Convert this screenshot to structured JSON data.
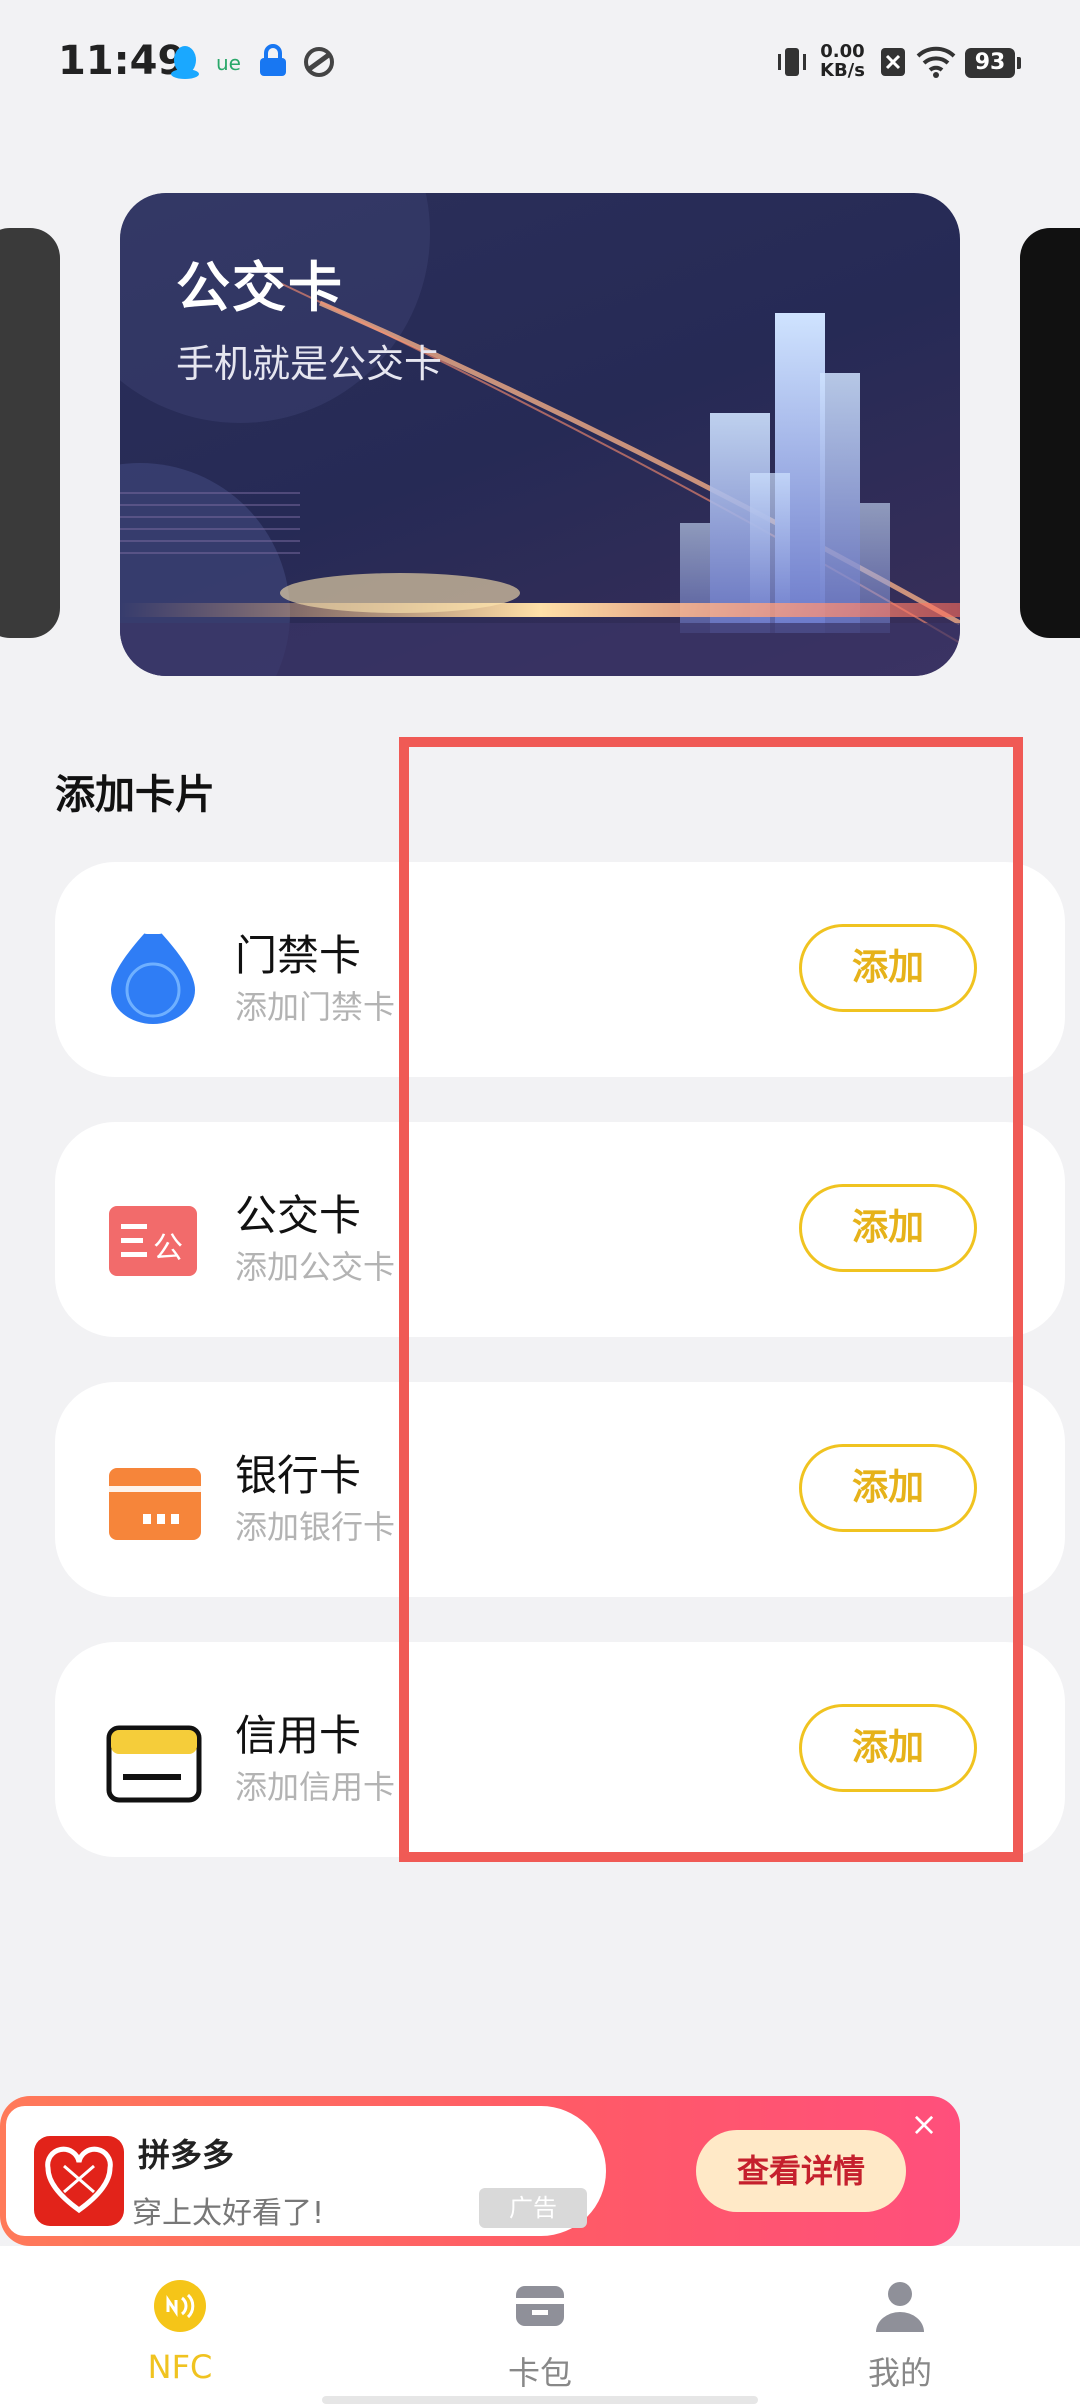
{
  "status_bar": {
    "time": "11:49",
    "net_speed_value": "0.00",
    "net_speed_unit": "KB/s",
    "battery": "93"
  },
  "banner": {
    "title": "公交卡",
    "subtitle": "手机就是公交卡"
  },
  "section": {
    "title": "添加卡片"
  },
  "cards": [
    {
      "name": "门禁卡",
      "desc": "添加门禁卡",
      "button": "添加",
      "icon": "access-card-icon"
    },
    {
      "name": "公交卡",
      "desc": "添加公交卡",
      "button": "添加",
      "icon": "bus-card-icon"
    },
    {
      "name": "银行卡",
      "desc": "添加银行卡",
      "button": "添加",
      "icon": "bank-card-icon"
    },
    {
      "name": "信用卡",
      "desc": "添加信用卡",
      "button": "添加",
      "icon": "credit-card-icon"
    }
  ],
  "ad": {
    "name": "拼多多",
    "desc": "穿上太好看了!",
    "tag": "广告",
    "button": "查看详情"
  },
  "nav": {
    "items": [
      {
        "label": "NFC",
        "icon": "nfc-icon",
        "active": true
      },
      {
        "label": "卡包",
        "icon": "wallet-icon",
        "active": false
      },
      {
        "label": "我的",
        "icon": "profile-icon",
        "active": false
      }
    ]
  },
  "colors": {
    "accent": "#f0c320",
    "highlight_box": "#f05a55",
    "background": "#f2f2f4"
  }
}
